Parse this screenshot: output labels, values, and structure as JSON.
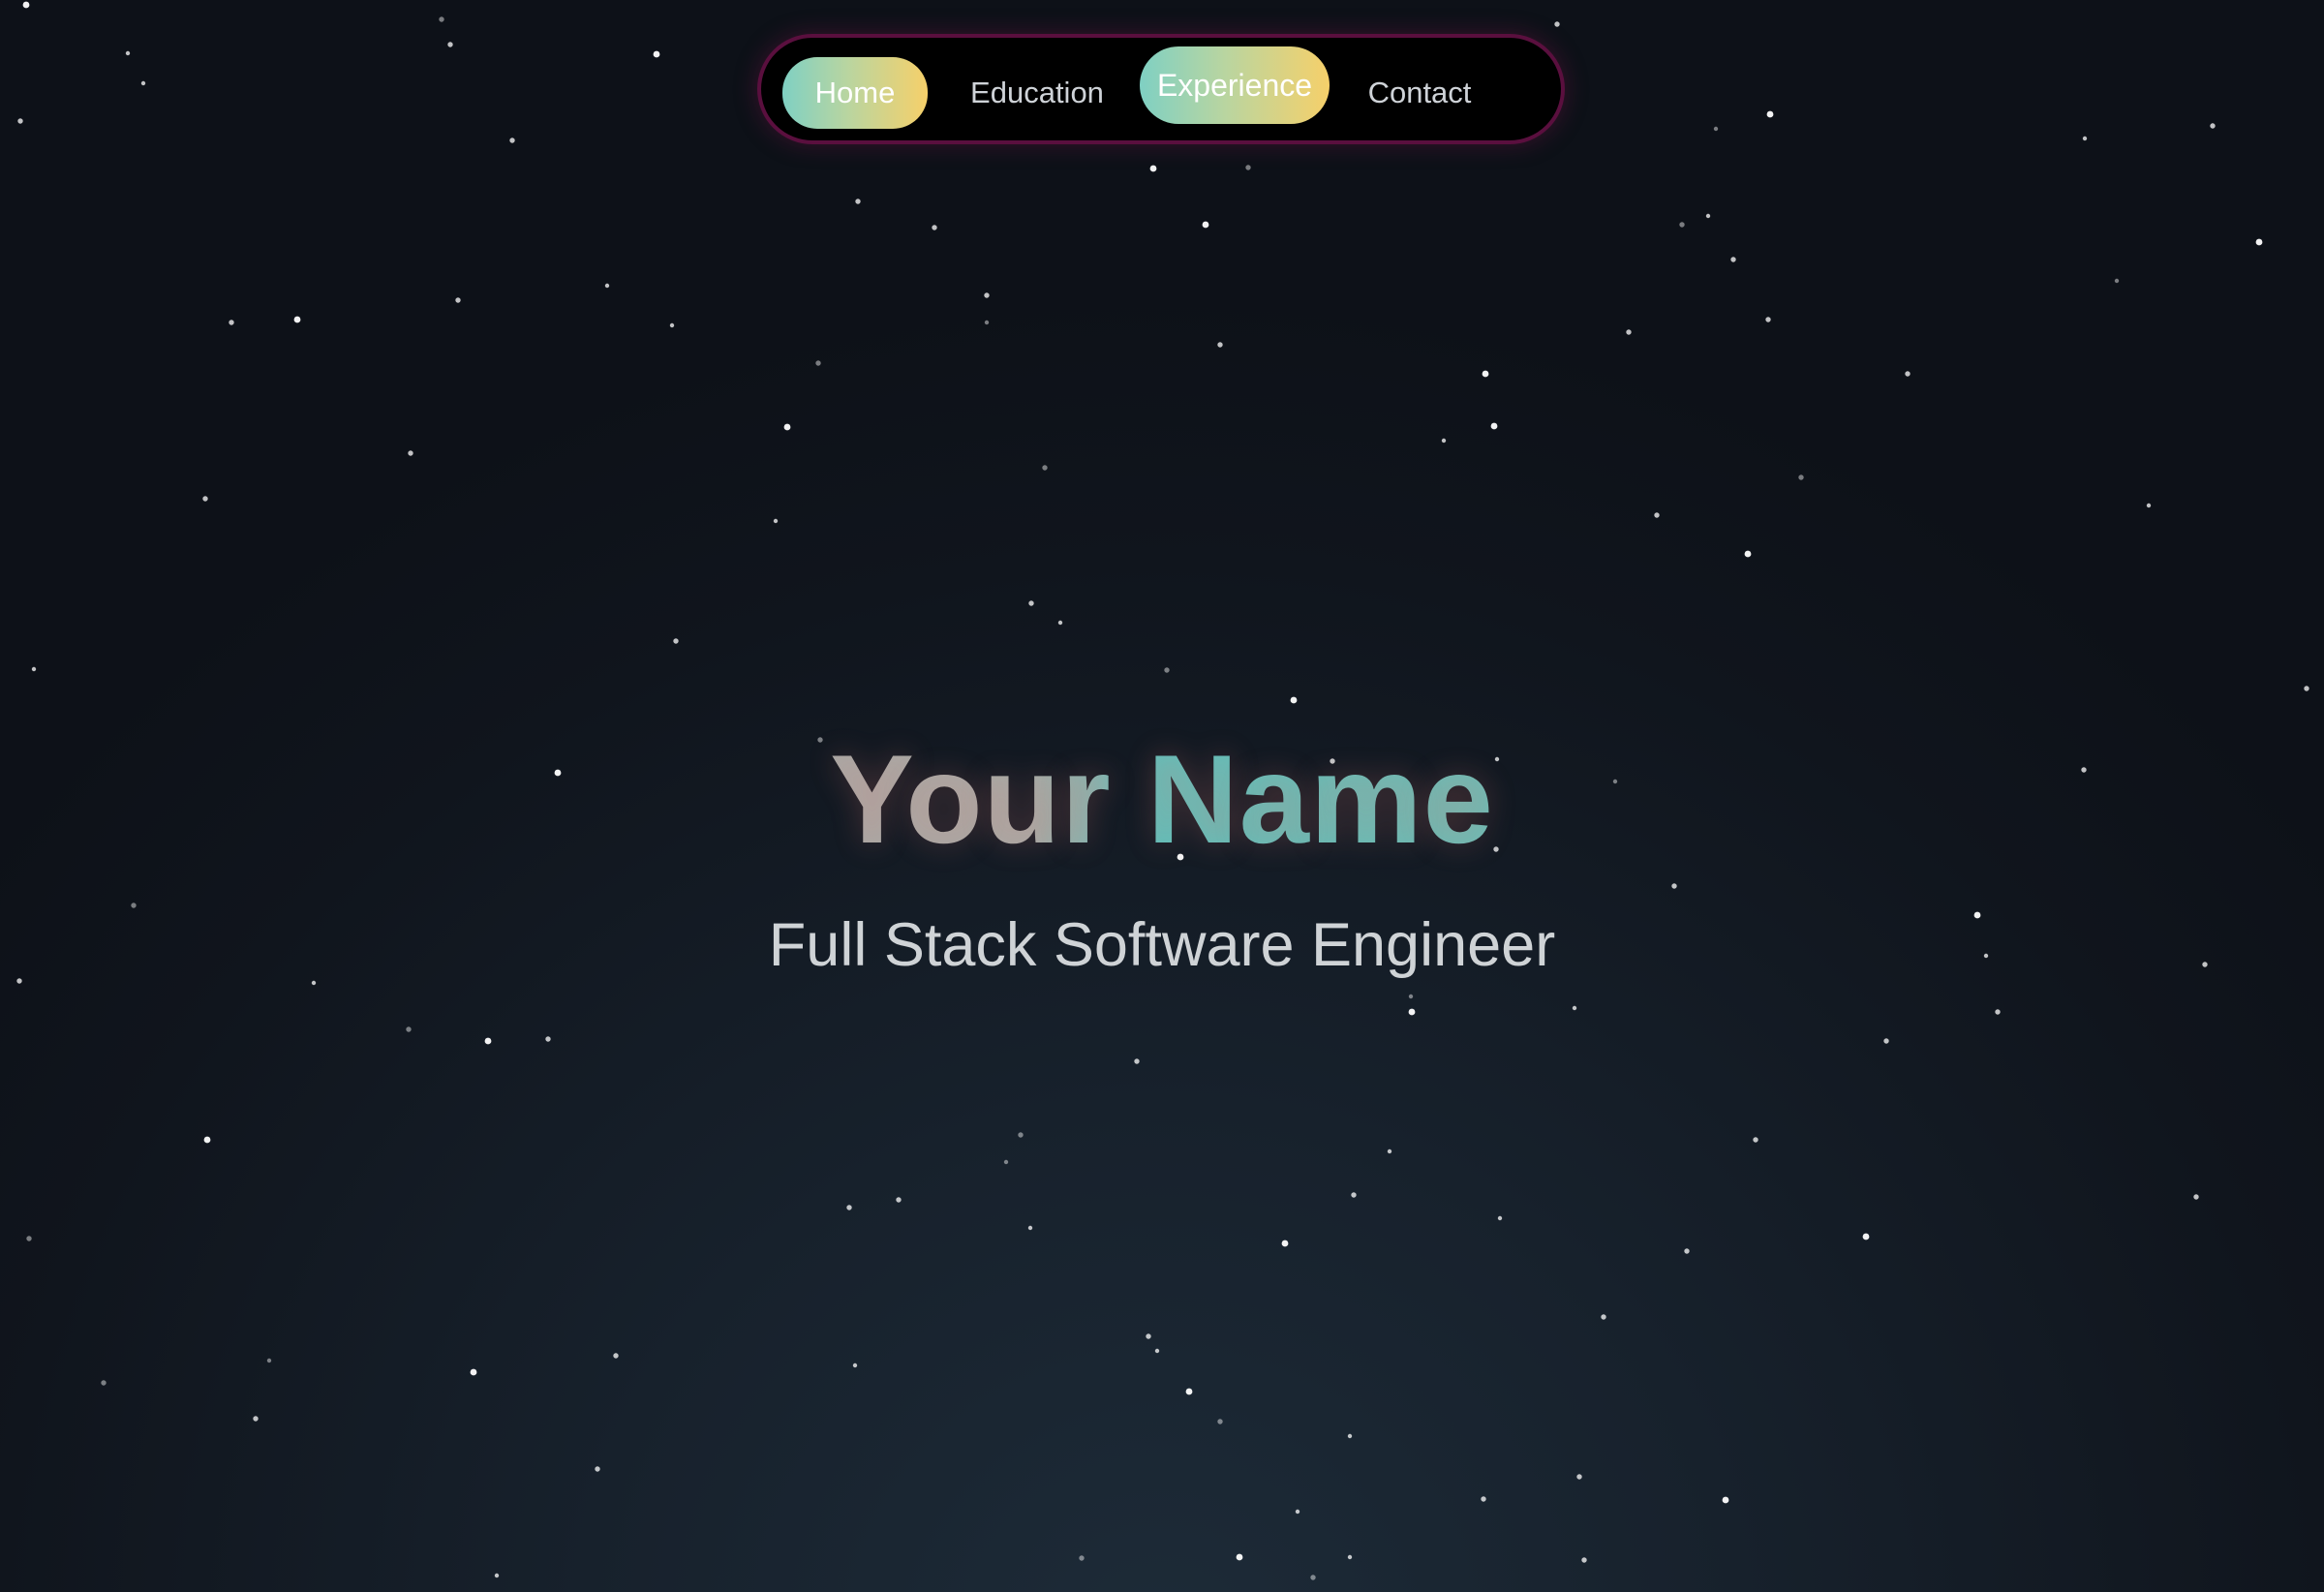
{
  "nav": {
    "items": [
      {
        "label": "Home",
        "active": true
      },
      {
        "label": "Education",
        "active": false
      },
      {
        "label": "Experience",
        "active": true
      },
      {
        "label": "Contact",
        "active": false
      }
    ]
  },
  "hero": {
    "title": "Your Name",
    "subtitle": "Full Stack Software Engineer"
  },
  "colors": {
    "background_dark": "#0d1118",
    "background_light": "#1d2b38",
    "nav_border": "#5a0f3e",
    "accent_teal": "#7fd0c3",
    "accent_yellow": "#f6d06a",
    "title_teal": "#5fc0bb",
    "subtitle_text": "#cfd3d6"
  }
}
